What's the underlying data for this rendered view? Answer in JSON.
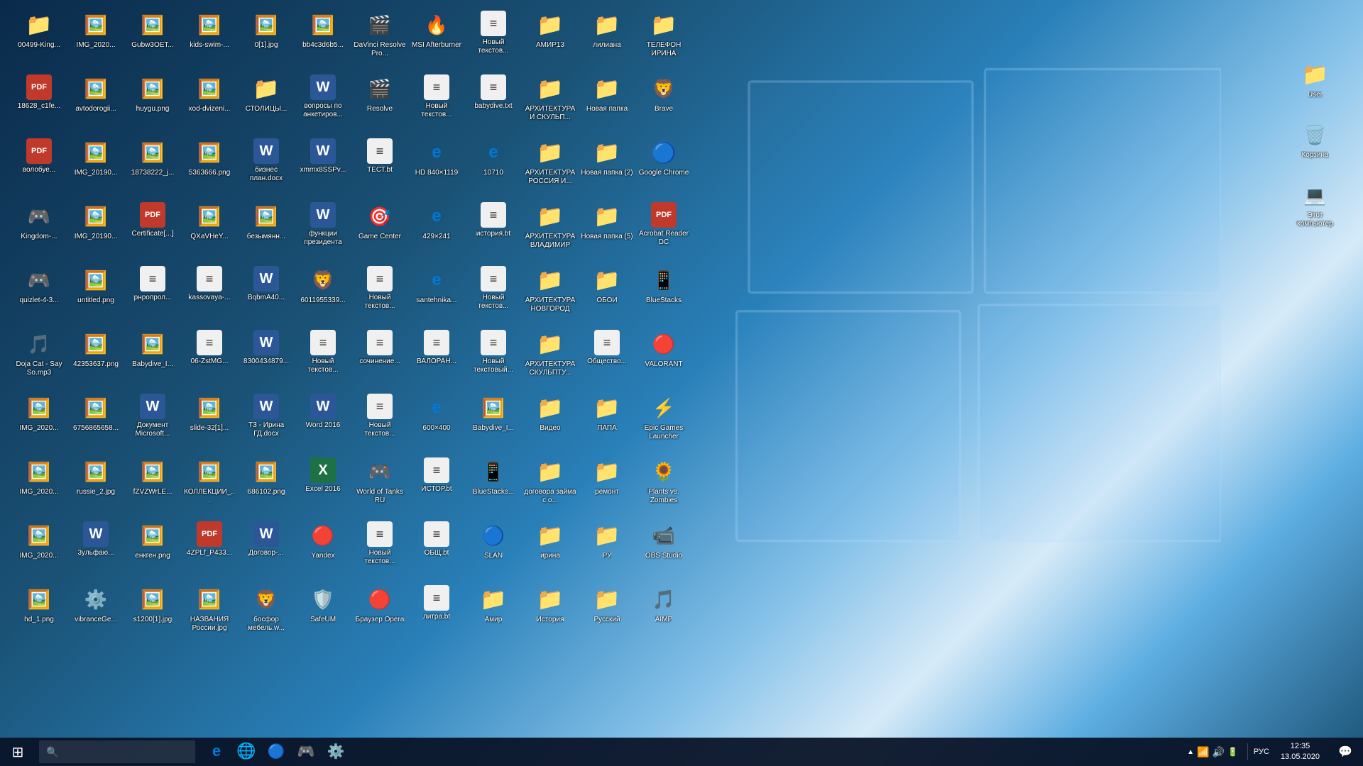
{
  "desktop": {
    "icons": [
      {
        "id": "i0",
        "label": "00499-King...",
        "type": "folder",
        "emoji": "📁"
      },
      {
        "id": "i1",
        "label": "IMG_2020...",
        "type": "image",
        "emoji": "🖼️"
      },
      {
        "id": "i2",
        "label": "Gubw3OET...",
        "type": "image",
        "emoji": "🖼️"
      },
      {
        "id": "i3",
        "label": "kids-swim-...",
        "type": "image",
        "emoji": "🖼️"
      },
      {
        "id": "i4",
        "label": "0[1].jpg",
        "type": "image",
        "emoji": "🖼️"
      },
      {
        "id": "i5",
        "label": "bb4c3d6b5...",
        "type": "image",
        "emoji": "🖼️"
      },
      {
        "id": "i6",
        "label": "DaVinci Resolve Pro...",
        "type": "app",
        "emoji": "🎬"
      },
      {
        "id": "i7",
        "label": "MSI Afterburner",
        "type": "app",
        "emoji": "🔥"
      },
      {
        "id": "i8",
        "label": "Новый текстов...",
        "type": "txt",
        "emoji": "📄"
      },
      {
        "id": "i9",
        "label": "АМИР13",
        "type": "folder",
        "emoji": "📁"
      },
      {
        "id": "i10",
        "label": "лилиана",
        "type": "folder",
        "emoji": "📁"
      },
      {
        "id": "i11",
        "label": "ТЕЛЕФОН ИРИНА",
        "type": "folder",
        "emoji": "📁"
      },
      {
        "id": "i12",
        "label": "18628_c1fe...",
        "type": "pdf",
        "emoji": "📕"
      },
      {
        "id": "i13",
        "label": "avtodorogii...",
        "type": "image",
        "emoji": "🖼️"
      },
      {
        "id": "i14",
        "label": "huygu.png",
        "type": "image",
        "emoji": "🖼️"
      },
      {
        "id": "i15",
        "label": "xod-dvizeni...",
        "type": "image",
        "emoji": "🖼️"
      },
      {
        "id": "i16",
        "label": "СТОЛИЦЫ...",
        "type": "folder",
        "emoji": "📁"
      },
      {
        "id": "i17",
        "label": "вопросы по анкетиров...",
        "type": "word",
        "emoji": "📘"
      },
      {
        "id": "i18",
        "label": "Resolve",
        "type": "app",
        "emoji": "🎬"
      },
      {
        "id": "i19",
        "label": "Новый текстов...",
        "type": "txt",
        "emoji": "📄"
      },
      {
        "id": "i20",
        "label": "babydive.txt",
        "type": "txt",
        "emoji": "📄"
      },
      {
        "id": "i21",
        "label": "АРХИТЕКТУРА И СКУЛЬП...",
        "type": "folder",
        "emoji": "📁"
      },
      {
        "id": "i22",
        "label": "Новая папка",
        "type": "folder",
        "emoji": "📁"
      },
      {
        "id": "i23",
        "label": "Brave",
        "type": "app",
        "emoji": "🦁"
      },
      {
        "id": "i24",
        "label": "волобуе...",
        "type": "pdf",
        "emoji": "📕"
      },
      {
        "id": "i25",
        "label": "IMG_20190...",
        "type": "image",
        "emoji": "🖼️"
      },
      {
        "id": "i26",
        "label": "18738222_j...",
        "type": "image",
        "emoji": "🖼️"
      },
      {
        "id": "i27",
        "label": "5363666.png",
        "type": "image",
        "emoji": "🖼️"
      },
      {
        "id": "i28",
        "label": "бизнес план.docx",
        "type": "word",
        "emoji": "📘"
      },
      {
        "id": "i29",
        "label": "xmmx8SSPv...",
        "type": "word",
        "emoji": "📘"
      },
      {
        "id": "i30",
        "label": "ТЕСТ.bt",
        "type": "txt",
        "emoji": "📄"
      },
      {
        "id": "i31",
        "label": "HD 840×1119",
        "type": "edge",
        "emoji": "🌐"
      },
      {
        "id": "i32",
        "label": "10710",
        "type": "edge",
        "emoji": "🌐"
      },
      {
        "id": "i33",
        "label": "АРХИТЕКТУРА РОССИЯ И...",
        "type": "folder",
        "emoji": "📁"
      },
      {
        "id": "i34",
        "label": "Новая папка (2)",
        "type": "folder",
        "emoji": "📁"
      },
      {
        "id": "i35",
        "label": "Google Chrome",
        "type": "chrome",
        "emoji": "🌐"
      },
      {
        "id": "i36",
        "label": "Kingdom-...",
        "type": "app",
        "emoji": "🎮"
      },
      {
        "id": "i37",
        "label": "IMG_20190...",
        "type": "image",
        "emoji": "🖼️"
      },
      {
        "id": "i38",
        "label": "Certificate[...]",
        "type": "pdf",
        "emoji": "📕"
      },
      {
        "id": "i39",
        "label": "QXaVHeY...",
        "type": "image",
        "emoji": "🖼️"
      },
      {
        "id": "i40",
        "label": "безымянн...",
        "type": "image",
        "emoji": "🖼️"
      },
      {
        "id": "i41",
        "label": "функции президента",
        "type": "word",
        "emoji": "📘"
      },
      {
        "id": "i42",
        "label": "Game Center",
        "type": "app",
        "emoji": "🎯"
      },
      {
        "id": "i43",
        "label": "429×241",
        "type": "edge",
        "emoji": "🌐"
      },
      {
        "id": "i44",
        "label": "история.bt",
        "type": "txt",
        "emoji": "📄"
      },
      {
        "id": "i45",
        "label": "АРХИТЕКТУРА ВЛАДИМИР",
        "type": "folder",
        "emoji": "📁"
      },
      {
        "id": "i46",
        "label": "Новая папка (5)",
        "type": "folder",
        "emoji": "📁"
      },
      {
        "id": "i47",
        "label": "Acrobat Reader DC",
        "type": "pdf",
        "emoji": "📕"
      },
      {
        "id": "i48",
        "label": "quizlet-4-3...",
        "type": "app",
        "emoji": "🎮"
      },
      {
        "id": "i49",
        "label": "untitled.png",
        "type": "image",
        "emoji": "🖼️"
      },
      {
        "id": "i50",
        "label": "рнропрол...",
        "type": "txt",
        "emoji": "📄"
      },
      {
        "id": "i51",
        "label": "kassovaya-...",
        "type": "txt",
        "emoji": "📄"
      },
      {
        "id": "i52",
        "label": "BqbmA40...",
        "type": "word",
        "emoji": "📘"
      },
      {
        "id": "i53",
        "label": "6011955339...",
        "type": "app",
        "emoji": "🦁"
      },
      {
        "id": "i54",
        "label": "Новый текстов...",
        "type": "txt",
        "emoji": "📄"
      },
      {
        "id": "i55",
        "label": "santehnika...",
        "type": "edge",
        "emoji": "🌐"
      },
      {
        "id": "i56",
        "label": "Новый текстов...",
        "type": "txt",
        "emoji": "📄"
      },
      {
        "id": "i57",
        "label": "АРХИТЕКТУРА НОВГОРОД",
        "type": "folder",
        "emoji": "📁"
      },
      {
        "id": "i58",
        "label": "ОБОИ",
        "type": "folder",
        "emoji": "📁"
      },
      {
        "id": "i59",
        "label": "BlueStacks",
        "type": "app",
        "emoji": "📱"
      },
      {
        "id": "i60",
        "label": "Doja Cat - Say So.mp3",
        "type": "audio",
        "emoji": "🎵"
      },
      {
        "id": "i61",
        "label": "42353637.png",
        "type": "image",
        "emoji": "🖼️"
      },
      {
        "id": "i62",
        "label": "Babydive_I...",
        "type": "image",
        "emoji": "🖼️"
      },
      {
        "id": "i63",
        "label": "06-ZstMG...",
        "type": "txt",
        "emoji": "📄"
      },
      {
        "id": "i64",
        "label": "8300434879...",
        "type": "word",
        "emoji": "📘"
      },
      {
        "id": "i65",
        "label": "Новый текстов...",
        "type": "txt",
        "emoji": "📄"
      },
      {
        "id": "i66",
        "label": "сочинение...",
        "type": "txt",
        "emoji": "📄"
      },
      {
        "id": "i67",
        "label": "ВАЛОРАН...",
        "type": "txt",
        "emoji": "📄"
      },
      {
        "id": "i68",
        "label": "Новый текстовый...",
        "type": "txt",
        "emoji": "📄"
      },
      {
        "id": "i69",
        "label": "АРХИТЕКТУРА СКУЛЬПТУ...",
        "type": "folder",
        "emoji": "📁"
      },
      {
        "id": "i70",
        "label": "Общество...",
        "type": "txt",
        "emoji": "📄"
      },
      {
        "id": "i71",
        "label": "VALORANT",
        "type": "app",
        "emoji": "🔴"
      },
      {
        "id": "i72",
        "label": "IMG_2020...",
        "type": "image",
        "emoji": "🖼️"
      },
      {
        "id": "i73",
        "label": "6756865658...",
        "type": "image",
        "emoji": "🖼️"
      },
      {
        "id": "i74",
        "label": "Документ Microsoft...",
        "type": "word",
        "emoji": "📘"
      },
      {
        "id": "i75",
        "label": "slide-32[1]...",
        "type": "image",
        "emoji": "🖼️"
      },
      {
        "id": "i76",
        "label": "ТЗ - Ирина ГД.docx",
        "type": "word",
        "emoji": "📘"
      },
      {
        "id": "i77",
        "label": "Word 2016",
        "type": "word",
        "emoji": "📘"
      },
      {
        "id": "i78",
        "label": "Новый текстов...",
        "type": "txt",
        "emoji": "📄"
      },
      {
        "id": "i79",
        "label": "600×400",
        "type": "edge",
        "emoji": "🌐"
      },
      {
        "id": "i80",
        "label": "Babydive_I...",
        "type": "image",
        "emoji": "🖼️"
      },
      {
        "id": "i81",
        "label": "Видео",
        "type": "folder",
        "emoji": "📁"
      },
      {
        "id": "i82",
        "label": "ПАПА",
        "type": "folder",
        "emoji": "📁"
      },
      {
        "id": "i83",
        "label": "Epic Games Launcher",
        "type": "app",
        "emoji": "⚡"
      },
      {
        "id": "i84",
        "label": "IMG_2020...",
        "type": "image",
        "emoji": "🖼️"
      },
      {
        "id": "i85",
        "label": "russie_2.jpg",
        "type": "image",
        "emoji": "🖼️"
      },
      {
        "id": "i86",
        "label": "fZVZWrLE...",
        "type": "image",
        "emoji": "🖼️"
      },
      {
        "id": "i87",
        "label": "КОЛЛЕКЦИИ_...",
        "type": "image",
        "emoji": "🖼️"
      },
      {
        "id": "i88",
        "label": "686102.png",
        "type": "image",
        "emoji": "🖼️"
      },
      {
        "id": "i89",
        "label": "Excel 2016",
        "type": "excel",
        "emoji": "📗"
      },
      {
        "id": "i90",
        "label": "World of Tanks RU",
        "type": "app",
        "emoji": "🎮"
      },
      {
        "id": "i91",
        "label": "ИСТОР.bt",
        "type": "txt",
        "emoji": "📄"
      },
      {
        "id": "i92",
        "label": "BlueStacks...",
        "type": "app",
        "emoji": "📱"
      },
      {
        "id": "i93",
        "label": "договора займа с о...",
        "type": "folder",
        "emoji": "📁"
      },
      {
        "id": "i94",
        "label": "ремонт",
        "type": "folder",
        "emoji": "📁"
      },
      {
        "id": "i95",
        "label": "Plants vs. Zombies",
        "type": "app",
        "emoji": "🌻"
      },
      {
        "id": "i96",
        "label": "IMG_2020...",
        "type": "image",
        "emoji": "🖼️"
      },
      {
        "id": "i97",
        "label": "3ульфаю...",
        "type": "word",
        "emoji": "📘"
      },
      {
        "id": "i98",
        "label": "енкген.png",
        "type": "image",
        "emoji": "🖼️"
      },
      {
        "id": "i99",
        "label": "4ZPLf_P433...",
        "type": "pdf",
        "emoji": "📕"
      },
      {
        "id": "i100",
        "label": "Договор-...",
        "type": "word",
        "emoji": "📘"
      },
      {
        "id": "i101",
        "label": "Yandex",
        "type": "app",
        "emoji": "🔴"
      },
      {
        "id": "i102",
        "label": "Новый текстов...",
        "type": "txt",
        "emoji": "📄"
      },
      {
        "id": "i103",
        "label": "ОБЩ.bt",
        "type": "txt",
        "emoji": "📄"
      },
      {
        "id": "i104",
        "label": "SLAN",
        "type": "app",
        "emoji": "🔵"
      },
      {
        "id": "i105",
        "label": "ирина",
        "type": "folder",
        "emoji": "📁"
      },
      {
        "id": "i106",
        "label": "РУ",
        "type": "folder",
        "emoji": "📁"
      },
      {
        "id": "i107",
        "label": "OBS Studio",
        "type": "app",
        "emoji": "📹"
      },
      {
        "id": "i108",
        "label": "hd_1.png",
        "type": "image",
        "emoji": "🖼️"
      },
      {
        "id": "i109",
        "label": "vibranceGe...",
        "type": "app",
        "emoji": "⚙️"
      },
      {
        "id": "i110",
        "label": "s1200[1].jpg",
        "type": "image",
        "emoji": "🖼️"
      },
      {
        "id": "i111",
        "label": "НАЗВАНИЯ России.jpg",
        "type": "image",
        "emoji": "🖼️"
      },
      {
        "id": "i112",
        "label": "босфор мебель.w...",
        "type": "app",
        "emoji": "🦁"
      },
      {
        "id": "i113",
        "label": "SafeUM",
        "type": "app",
        "emoji": "🛡️"
      },
      {
        "id": "i114",
        "label": "Браузер Opera",
        "type": "app",
        "emoji": "🔴"
      },
      {
        "id": "i115",
        "label": "литра.bt",
        "type": "txt",
        "emoji": "📄"
      },
      {
        "id": "i116",
        "label": "Амир",
        "type": "folder",
        "emoji": "📁"
      },
      {
        "id": "i117",
        "label": "История",
        "type": "folder",
        "emoji": "📁"
      },
      {
        "id": "i118",
        "label": "Русский",
        "type": "folder",
        "emoji": "📁"
      },
      {
        "id": "i119",
        "label": "AIMP",
        "type": "app",
        "emoji": "🎵"
      }
    ],
    "right_icons": [
      {
        "id": "r0",
        "label": "User",
        "type": "folder",
        "emoji": "👤"
      },
      {
        "id": "r1",
        "label": "Корзина",
        "type": "trash",
        "emoji": "🗑️"
      },
      {
        "id": "r2",
        "label": "Этот компьютер",
        "type": "computer",
        "emoji": "💻"
      }
    ]
  },
  "taskbar": {
    "start_label": "⊞",
    "search_placeholder": "🔍",
    "clock_time": "12:35",
    "clock_date": "13.05.2020",
    "lang": "РУС",
    "apps": [
      {
        "label": "⊞",
        "name": "start"
      },
      {
        "label": "🔍",
        "name": "search"
      },
      {
        "label": "e",
        "name": "edge"
      },
      {
        "label": "🦊",
        "name": "firefox-ish"
      },
      {
        "label": "🌐",
        "name": "chrome"
      },
      {
        "label": "🎮",
        "name": "steam"
      },
      {
        "label": "⚙️",
        "name": "settings"
      }
    ]
  }
}
